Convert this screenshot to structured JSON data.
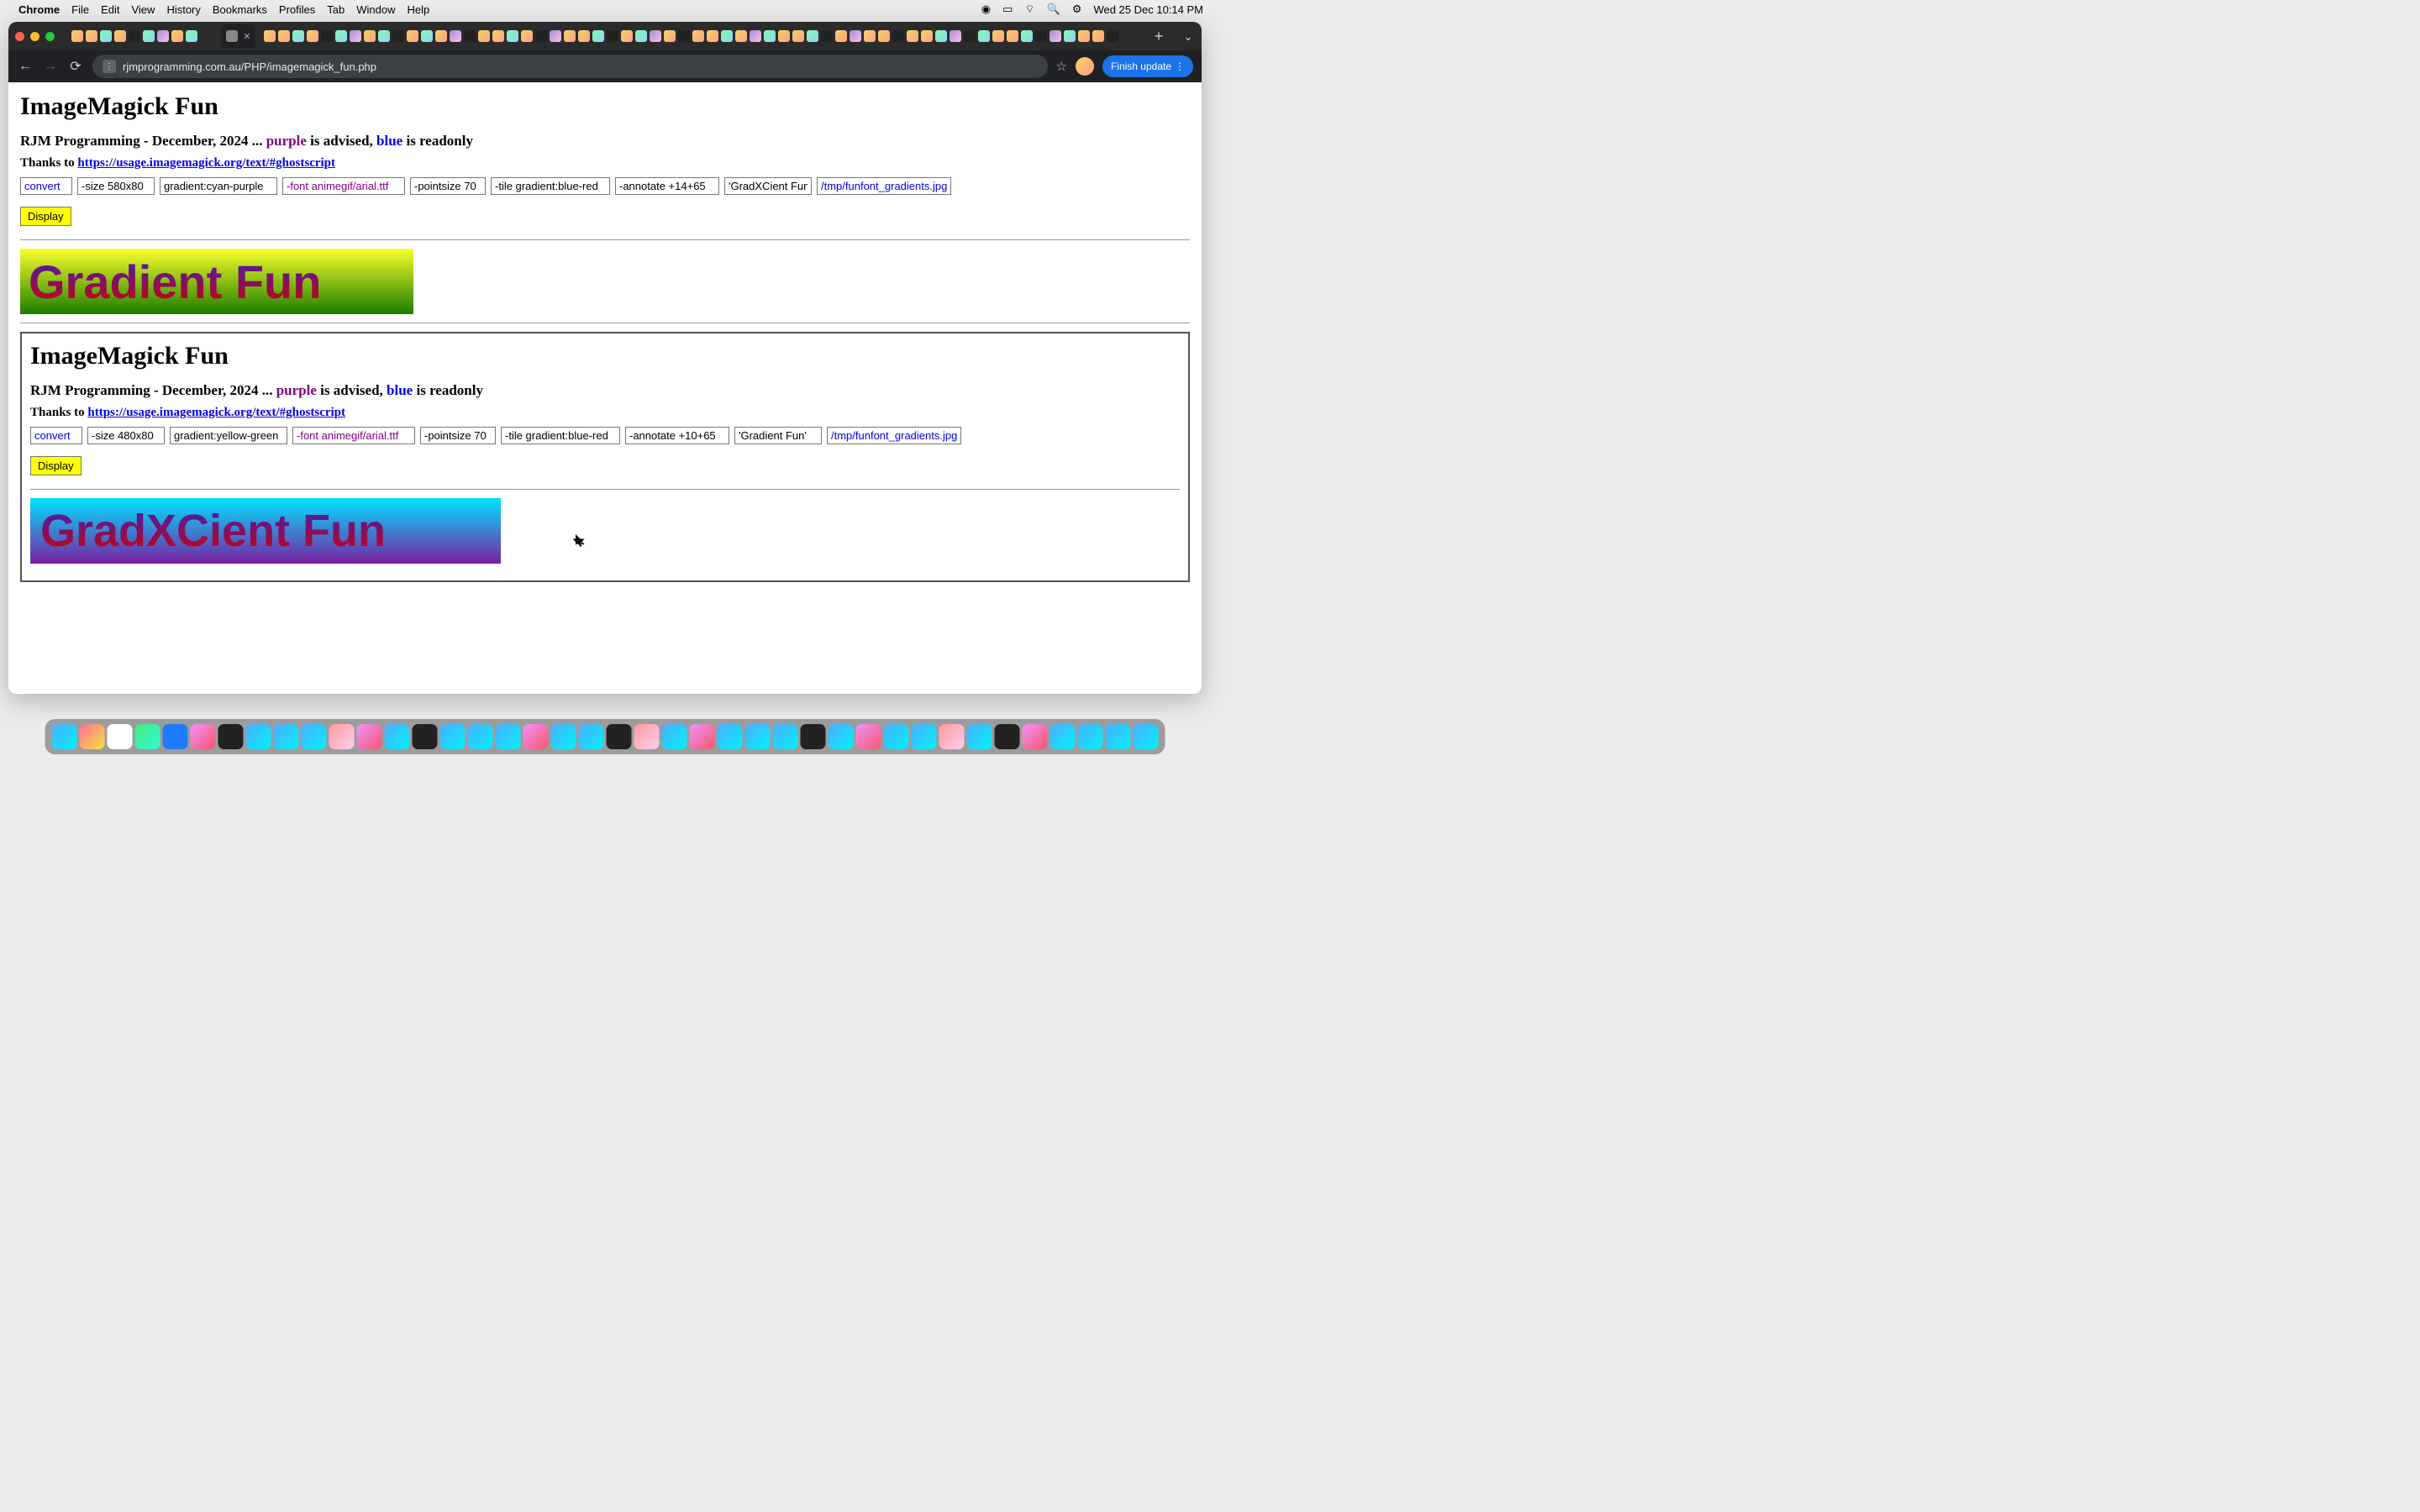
{
  "menubar": {
    "app": "Chrome",
    "items": [
      "File",
      "Edit",
      "View",
      "History",
      "Bookmarks",
      "Profiles",
      "Tab",
      "Window",
      "Help"
    ],
    "clock": "Wed 25 Dec  10:14 PM"
  },
  "chrome": {
    "url": "rjmprogramming.com.au/PHP/imagemagick_fun.php",
    "finish_update": "Finish update",
    "newtab": "+",
    "overflow": "⌄"
  },
  "main": {
    "h1": "ImageMagick Fun",
    "byline_prefix": "RJM Programming - December, 2024 ... ",
    "byline_purple": "purple",
    "byline_mid": " is advised, ",
    "byline_blue": "blue",
    "byline_suffix": " is readonly",
    "thanks_prefix": "Thanks to ",
    "thanks_link": "https://usage.imagemagick.org/text/#ghostscript",
    "row": {
      "f0": "convert",
      "f1": "-size 580x80",
      "f2": "gradient:cyan-purple",
      "f3": "-font animegif/arial.ttf",
      "f4": "-pointsize 70",
      "f5": "-tile gradient:blue-red",
      "f6": "-annotate +14+65",
      "f7": "'GradXCient Fun'",
      "f8": "/tmp/funfont_gradients.jpg"
    },
    "display": "Display",
    "grad_text": "Gradient Fun"
  },
  "inner": {
    "h1": "ImageMagick Fun",
    "byline_prefix": "RJM Programming - December, 2024 ... ",
    "byline_purple": "purple",
    "byline_mid": " is advised, ",
    "byline_blue": "blue",
    "byline_suffix": " is readonly",
    "thanks_prefix": "Thanks to ",
    "thanks_link": "https://usage.imagemagick.org/text/#ghostscript",
    "row": {
      "f0": "convert",
      "f1": "-size 480x80",
      "f2": "gradient:yellow-green",
      "f3": "-font animegif/arial.ttf",
      "f4": "-pointsize 70",
      "f5": "-tile gradient:blue-red",
      "f6": "-annotate +10+65",
      "f7": "'Gradient Fun'",
      "f8": "/tmp/funfont_gradients.jpg"
    },
    "display": "Display",
    "grad_text": "GradXCient Fun"
  }
}
